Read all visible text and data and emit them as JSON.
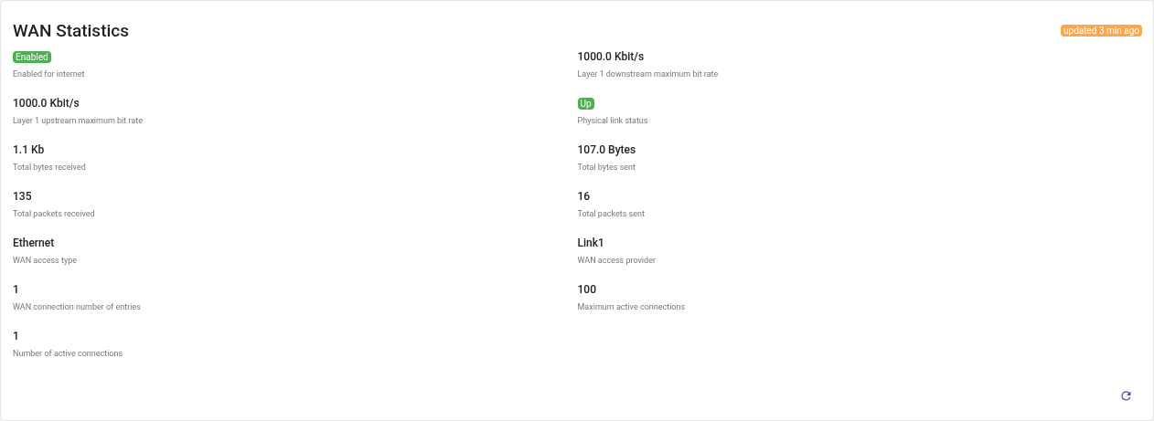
{
  "card": {
    "title": "WAN Statistics",
    "updated": "updated 3 min ago",
    "items": [
      {
        "kind": "badge",
        "value": "Enabled",
        "label": "Enabled for internet"
      },
      {
        "kind": "text",
        "value": "1000.0 Kbit/s",
        "label": "Layer 1 downstream maximum bit rate"
      },
      {
        "kind": "text",
        "value": "1000.0 Kbit/s",
        "label": "Layer 1 upstream maximum bit rate"
      },
      {
        "kind": "badge",
        "value": "Up",
        "label": "Physical link status"
      },
      {
        "kind": "text",
        "value": "1.1 Kb",
        "label": "Total bytes received"
      },
      {
        "kind": "text",
        "value": "107.0 Bytes",
        "label": "Total bytes sent"
      },
      {
        "kind": "text",
        "value": "135",
        "label": "Total packets received"
      },
      {
        "kind": "text",
        "value": "16",
        "label": "Total packets sent"
      },
      {
        "kind": "text",
        "value": "Ethernet",
        "label": "WAN access type"
      },
      {
        "kind": "text",
        "value": "Link1",
        "label": "WAN access provider"
      },
      {
        "kind": "text",
        "value": "1",
        "label": "WAN connection number of entries"
      },
      {
        "kind": "text",
        "value": "100",
        "label": "Maximum active connections"
      },
      {
        "kind": "text",
        "value": "1",
        "label": "Number of active connections"
      }
    ]
  }
}
